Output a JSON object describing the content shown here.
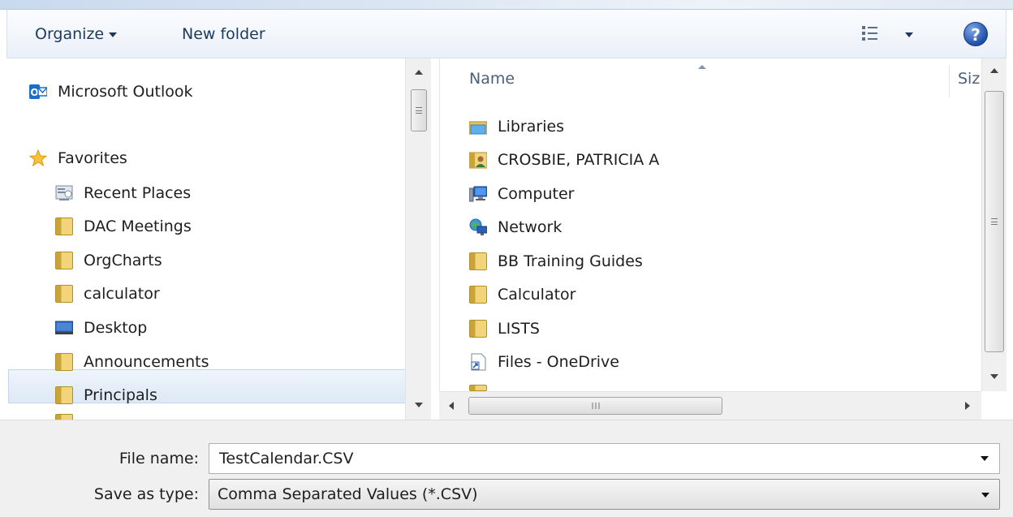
{
  "toolbar": {
    "organize_label": "Organize",
    "new_folder_label": "New folder",
    "help_label": "?"
  },
  "nav": {
    "items": [
      {
        "label": "Microsoft Outlook",
        "icon": "outlook-icon"
      },
      {
        "label": "Favorites",
        "icon": "star-icon"
      },
      {
        "label": "Recent Places",
        "icon": "recent-places-icon"
      },
      {
        "label": "DAC Meetings",
        "icon": "folder-icon"
      },
      {
        "label": "OrgCharts",
        "icon": "folder-icon"
      },
      {
        "label": "calculator",
        "icon": "folder-icon"
      },
      {
        "label": "Desktop",
        "icon": "desktop-icon",
        "selected": true
      },
      {
        "label": "Announcements",
        "icon": "folder-icon"
      },
      {
        "label": "Principals",
        "icon": "folder-icon"
      }
    ]
  },
  "content": {
    "columns": {
      "name": "Name",
      "size": "Siz"
    },
    "items": [
      {
        "label": "Libraries",
        "icon": "libraries-icon"
      },
      {
        "label": "CROSBIE, PATRICIA A",
        "icon": "user-folder-icon"
      },
      {
        "label": "Computer",
        "icon": "computer-icon"
      },
      {
        "label": "Network",
        "icon": "network-icon"
      },
      {
        "label": "BB Training Guides",
        "icon": "folder-icon"
      },
      {
        "label": "Calculator",
        "icon": "folder-icon"
      },
      {
        "label": "LISTS",
        "icon": "folder-icon"
      },
      {
        "label": "Files - OneDrive",
        "icon": "shortcut-icon"
      }
    ]
  },
  "form": {
    "file_name_label": "File name:",
    "file_name_value": "TestCalendar.CSV",
    "save_type_label": "Save as type:",
    "save_type_value": "Comma Separated Values (*.CSV)"
  },
  "colors": {
    "accent": "#1e395b",
    "selection": "#dde9f5",
    "folder": "#f2d57a"
  }
}
